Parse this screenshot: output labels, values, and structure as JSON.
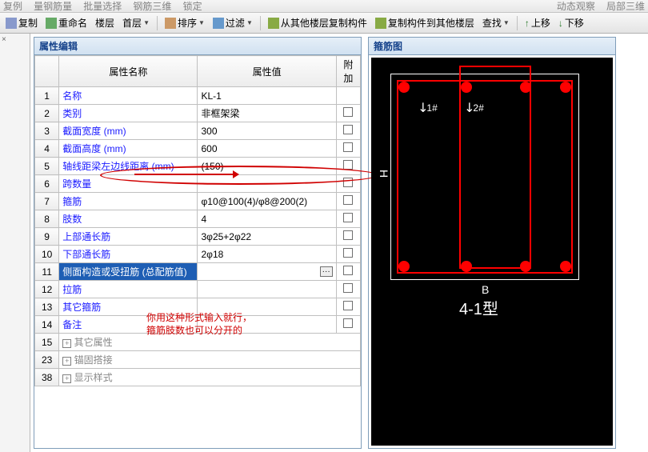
{
  "toolbar": {
    "top_fragments": [
      "复例",
      "量钢筋量",
      "批量选择",
      "钢筋三维",
      "锁定",
      "动态观察",
      "局部三维"
    ],
    "items": [
      {
        "label": "复制"
      },
      {
        "label": "重命名"
      },
      {
        "label": "楼层"
      },
      {
        "label": "首层"
      },
      {
        "label": "排序"
      },
      {
        "label": "过滤"
      },
      {
        "label": "从其他楼层复制构件"
      },
      {
        "label": "复制构件到其他楼层"
      },
      {
        "label": "查找"
      },
      {
        "label": "上移"
      },
      {
        "label": "下移"
      }
    ]
  },
  "panel_titles": {
    "prop": "属性编辑",
    "rebar": "箍筋图"
  },
  "columns": {
    "name": "属性名称",
    "value": "属性值",
    "add": "附加"
  },
  "rows": [
    {
      "no": "1",
      "name": "名称",
      "value": "KL-1",
      "chk": false
    },
    {
      "no": "2",
      "name": "类别",
      "value": "非框架梁",
      "chk": true
    },
    {
      "no": "3",
      "name": "截面宽度 (mm)",
      "value": "300",
      "chk": true
    },
    {
      "no": "4",
      "name": "截面高度 (mm)",
      "value": "600",
      "chk": true
    },
    {
      "no": "5",
      "name": "轴线距梁左边线距离 (mm)",
      "value": "(150)",
      "chk": true
    },
    {
      "no": "6",
      "name": "跨数量",
      "value": "",
      "chk": true
    },
    {
      "no": "7",
      "name": "箍筋",
      "value": "φ10@100(4)/φ8@200(2)",
      "chk": true
    },
    {
      "no": "8",
      "name": "肢数",
      "value": "4",
      "chk": true
    },
    {
      "no": "9",
      "name": "上部通长筋",
      "value": "3φ25+2φ22",
      "chk": true
    },
    {
      "no": "10",
      "name": "下部通长筋",
      "value": "2φ18",
      "chk": true
    },
    {
      "no": "11",
      "name": "侧面构造或受扭筋 (总配筋值)",
      "value": "",
      "chk": true,
      "sel": true,
      "dots": true
    },
    {
      "no": "12",
      "name": "拉筋",
      "value": "",
      "chk": true
    },
    {
      "no": "13",
      "name": "其它箍筋",
      "value": "",
      "chk": true
    },
    {
      "no": "14",
      "name": "备注",
      "value": "",
      "chk": true
    }
  ],
  "groups": [
    {
      "no": "15",
      "exp": "+",
      "name": "其它属性"
    },
    {
      "no": "23",
      "exp": "+",
      "name": "锚固搭接"
    },
    {
      "no": "38",
      "exp": "+",
      "name": "显示样式"
    }
  ],
  "note": {
    "l1": "你用这种形式输入就行，",
    "l2": "箍筋肢数也可以分开的"
  },
  "diagram": {
    "lab1": "1#",
    "lab2": "2#",
    "H": "H",
    "B": "B",
    "type": "4-1型"
  }
}
